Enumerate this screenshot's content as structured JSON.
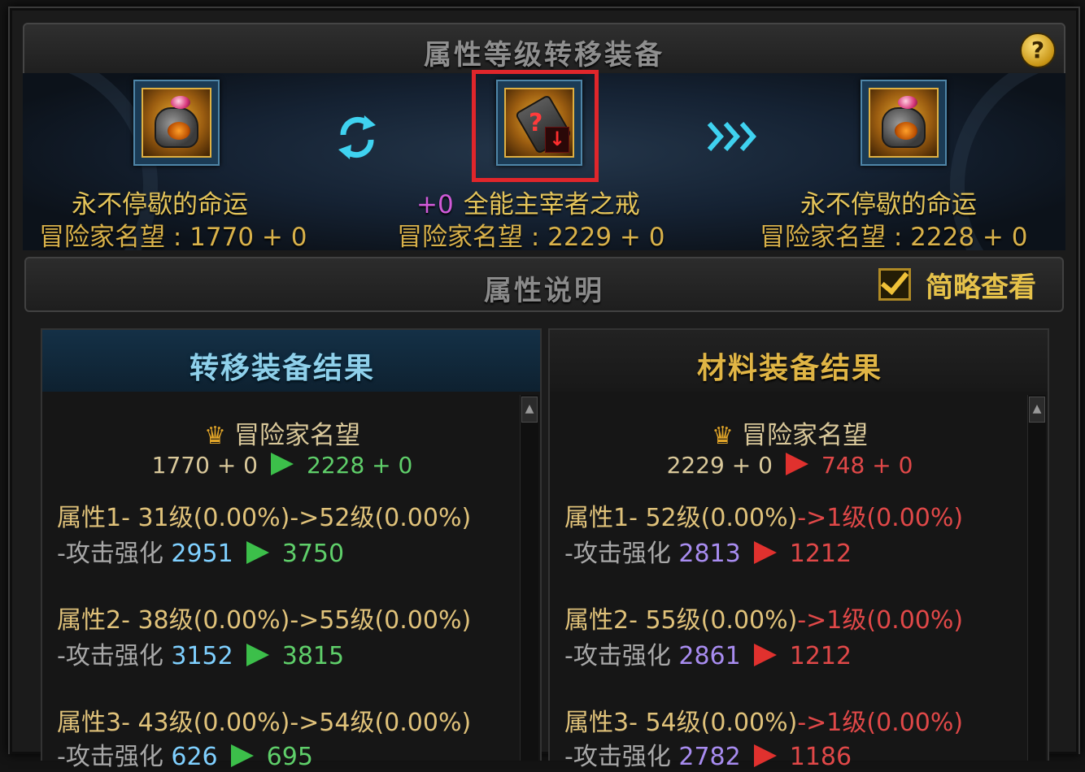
{
  "window": {
    "title": "属性等级转移装备",
    "help_label": "?"
  },
  "transfer": {
    "left": {
      "name": "永不停歇的命运",
      "rep_line": "冒险家名望 : 1770 + 0"
    },
    "center": {
      "plus": "+0",
      "name": "全能主宰者之戒",
      "rep_line": "冒险家名望 : 2229 + 0"
    },
    "right": {
      "name": "永不停歇的命运",
      "rep_line": "冒险家名望 : 2228 + 0"
    },
    "icons": [
      "cycle-icon",
      "triple-arrow-icon",
      "helmet-icon",
      "ring-icon",
      "down-arrow-icon"
    ]
  },
  "section": {
    "title": "属性说明",
    "checkbox_label": "简略查看",
    "checkbox_checked": true
  },
  "left_panel": {
    "title": "转移装备结果",
    "rep_label": "冒险家名望",
    "rep_from": "1770 + 0",
    "rep_to": "2228 + 0",
    "attrs": [
      {
        "label": "属性1- 31级(0.00%)->52级(0.00%)",
        "stat": "-攻击强化",
        "from": "2951",
        "to": "3750"
      },
      {
        "label": "属性2- 38级(0.00%)->55级(0.00%)",
        "stat": "-攻击强化",
        "from": "3152",
        "to": "3815"
      },
      {
        "label": "属性3- 43级(0.00%)->54级(0.00%)",
        "stat": "-攻击强化",
        "from": "626",
        "to": "695"
      }
    ],
    "colors": {
      "arrow": "#3cbf4a",
      "result": "#5fcf6a"
    }
  },
  "right_panel": {
    "title": "材料装备结果",
    "rep_label": "冒险家名望",
    "rep_from": "2229 + 0",
    "rep_to": "748 + 0",
    "attrs": [
      {
        "label_a": "属性1- 52级(0.00%)",
        "label_b": "->1级(0.00%)",
        "stat": "-攻击强化",
        "from": "2813",
        "to": "1212"
      },
      {
        "label_a": "属性2- 55级(0.00%)",
        "label_b": "->1级(0.00%)",
        "stat": "-攻击强化",
        "from": "2861",
        "to": "1212"
      },
      {
        "label_a": "属性3- 54级(0.00%)",
        "label_b": "->1级(0.00%)",
        "stat": "-攻击强化",
        "from": "2782",
        "to": "1186"
      }
    ],
    "colors": {
      "arrow": "#e0312e",
      "result": "#e04848"
    }
  }
}
